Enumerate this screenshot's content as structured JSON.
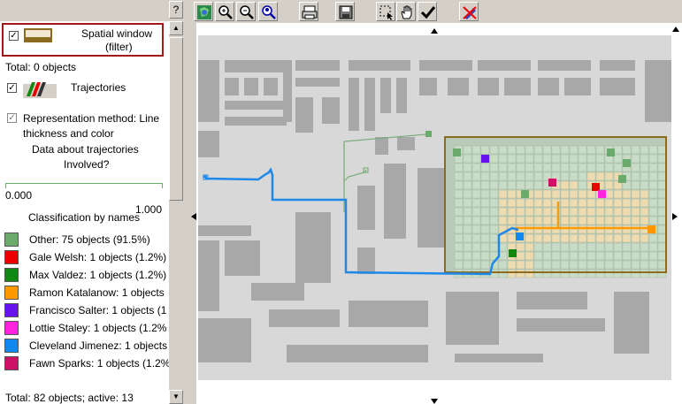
{
  "left_panel": {
    "help_button": "?",
    "spatial_window": {
      "line1": "Spatial window",
      "line2": "(filter)",
      "checked": true
    },
    "total_objects": "Total: 0 objects",
    "trajectories": {
      "label": "Trajectories",
      "checked": true
    },
    "representation": {
      "line1": "Representation method: Line",
      "line2": "thickness and color",
      "checked": true
    },
    "data_about": {
      "line1": "Data about trajectories",
      "line2": "Involved?"
    },
    "slider": {
      "min": "0.000",
      "max": "1.000"
    },
    "classification_title": "Classification by names",
    "legend": [
      {
        "label": "Other: 75 objects (91.5%)",
        "color": "#6aaa6a"
      },
      {
        "label": "Gale Welsh: 1 objects (1.2%)",
        "color": "#ee0000"
      },
      {
        "label": "Max Valdez: 1 objects (1.2%)",
        "color": "#118811"
      },
      {
        "label": "Ramon Katalanow: 1 objects",
        "color": "#ff9900"
      },
      {
        "label": "Francisco Salter: 1 objects (1",
        "color": "#6611ee"
      },
      {
        "label": "Lottie Staley: 1 objects (1.2%",
        "color": "#ff22dd"
      },
      {
        "label": "Cleveland Jimenez: 1 objects",
        "color": "#1188ee"
      },
      {
        "label": "Fawn Sparks: 1 objects (1.2%",
        "color": "#cc1166"
      }
    ],
    "total_active": "Total: 82 objects; active: 13"
  },
  "toolbar": {
    "buttons": [
      {
        "name": "map-globe-icon"
      },
      {
        "name": "zoom-in-icon"
      },
      {
        "name": "zoom-out-icon"
      },
      {
        "name": "zoom-person-icon"
      },
      {
        "name": "print-icon"
      },
      {
        "name": "save-icon"
      },
      {
        "name": "select-region-icon"
      },
      {
        "name": "pan-hand-icon"
      },
      {
        "name": "checkmark-icon"
      },
      {
        "name": "erase-icon"
      }
    ]
  },
  "map": {
    "background": "#d8d8d8",
    "building_color": "#a8a8a8",
    "filter_rect_color": "#8b6b1e",
    "trajectory_color": "#1e88e8",
    "orange_path_color": "#ff9900",
    "green_path_color": "#7aaa7a"
  }
}
